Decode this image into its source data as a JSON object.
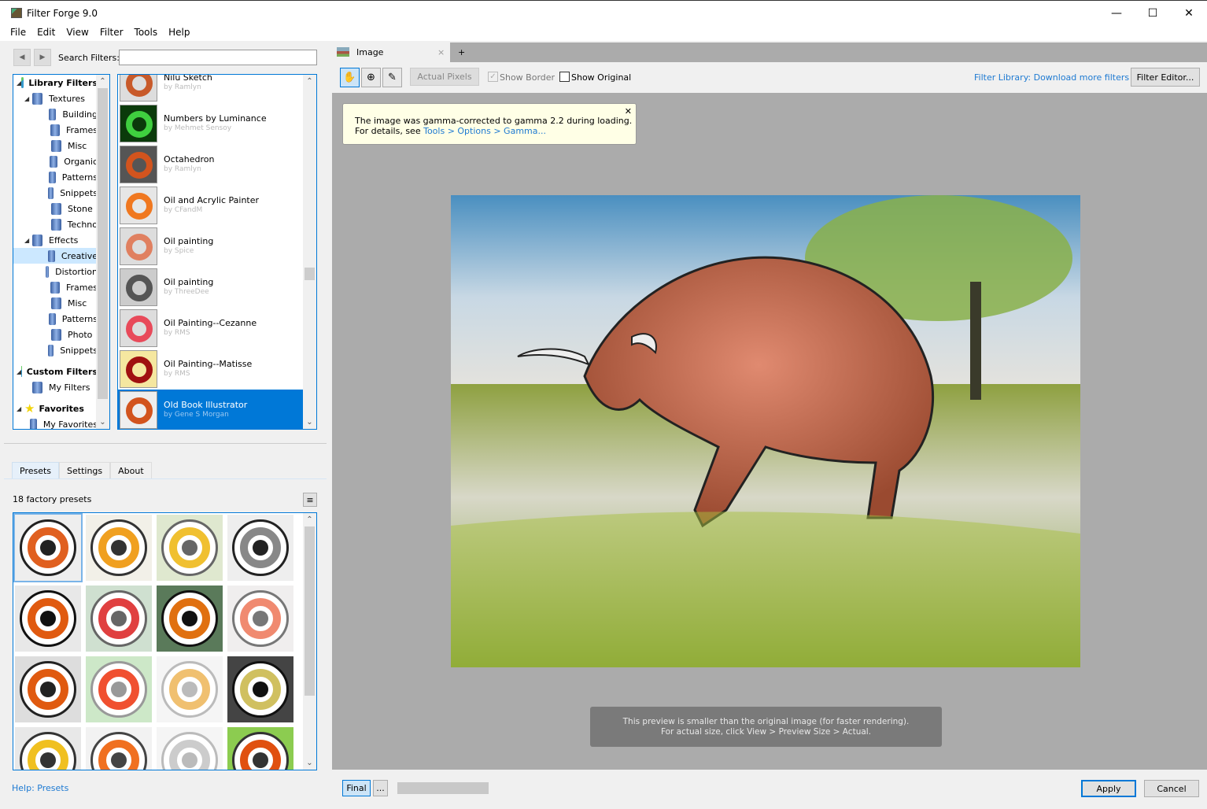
{
  "window": {
    "title": "Filter Forge 9.0",
    "minimize": "—",
    "maximize": "☐",
    "close": "✕"
  },
  "menu": [
    "File",
    "Edit",
    "View",
    "Filter",
    "Tools",
    "Help"
  ],
  "search": {
    "label": "Search Filters:",
    "value": ""
  },
  "tree": [
    {
      "label": "Library Filters",
      "level": 0,
      "bold": true,
      "icon": "cube-icon"
    },
    {
      "label": "Textures",
      "level": 1
    },
    {
      "label": "Building",
      "level": 2
    },
    {
      "label": "Frames",
      "level": 2
    },
    {
      "label": "Misc",
      "level": 2
    },
    {
      "label": "Organic",
      "level": 2
    },
    {
      "label": "Patterns",
      "level": 2
    },
    {
      "label": "Snippets",
      "level": 2
    },
    {
      "label": "Stone",
      "level": 2
    },
    {
      "label": "Techno",
      "level": 2
    },
    {
      "label": "Effects",
      "level": 1
    },
    {
      "label": "Creative",
      "level": 2,
      "selected": true
    },
    {
      "label": "Distortion",
      "level": 2
    },
    {
      "label": "Frames",
      "level": 2
    },
    {
      "label": "Misc",
      "level": 2
    },
    {
      "label": "Patterns",
      "level": 2
    },
    {
      "label": "Photo",
      "level": 2
    },
    {
      "label": "Snippets",
      "level": 2
    },
    {
      "label": "Custom Filters",
      "level": 0,
      "bold": true,
      "icon": "cube-icon"
    },
    {
      "label": "My Filters",
      "level": 1
    },
    {
      "label": "Favorites",
      "level": 0,
      "bold": true,
      "icon": "star-icon"
    },
    {
      "label": "My Favorites",
      "level": 1
    }
  ],
  "filters": [
    {
      "name": "Nilu Sketch",
      "author": "by Ramlyn",
      "colors": [
        "#ddd",
        "#c85a2a"
      ]
    },
    {
      "name": "Numbers by Luminance",
      "author": "by Mehmet Sensoy",
      "colors": [
        "#0b3a0b",
        "#3fcf3f"
      ]
    },
    {
      "name": "Octahedron",
      "author": "by Ramlyn",
      "colors": [
        "#555",
        "#d2541e"
      ]
    },
    {
      "name": "Oil and Acrylic Painter",
      "author": "by CFandM",
      "colors": [
        "#e6e6e6",
        "#f07820"
      ]
    },
    {
      "name": "Oil painting",
      "author": "by Spice",
      "colors": [
        "#ddd",
        "#e08060"
      ]
    },
    {
      "name": "Oil painting",
      "author": "by ThreeDee",
      "colors": [
        "#ccc",
        "#555"
      ]
    },
    {
      "name": "Oil Painting--Cezanne",
      "author": "by RMS",
      "colors": [
        "#ddd",
        "#e84a5a"
      ]
    },
    {
      "name": "Oil Painting--Matisse",
      "author": "by RMS",
      "colors": [
        "#f5e7a0",
        "#a01010"
      ]
    },
    {
      "name": "Old Book Illustrator",
      "author": "by Gene S Morgan",
      "colors": [
        "#eee",
        "#d2541e"
      ],
      "selected": true
    }
  ],
  "tabs": [
    "Presets",
    "Settings",
    "About"
  ],
  "presets_count": "18 factory presets",
  "presets": [
    {
      "bg": "#eee",
      "ring": "#e06020",
      "ink": "#222"
    },
    {
      "bg": "#f2f0e8",
      "ring": "#f0a020",
      "ink": "#333"
    },
    {
      "bg": "#dfe8cf",
      "ring": "#f0c030",
      "ink": "#666"
    },
    {
      "bg": "#eee",
      "ring": "#888",
      "ink": "#222"
    },
    {
      "bg": "#e8e8e8",
      "ring": "#e05a10",
      "ink": "#111"
    },
    {
      "bg": "#cfe0d0",
      "ring": "#e04040",
      "ink": "#666"
    },
    {
      "bg": "#5a7a5a",
      "ring": "#e07010",
      "ink": "#111"
    },
    {
      "bg": "#f0eeee",
      "ring": "#f08a70",
      "ink": "#777"
    },
    {
      "bg": "#ddd",
      "ring": "#e05a10",
      "ink": "#222"
    },
    {
      "bg": "#cde8c8",
      "ring": "#f05030",
      "ink": "#999"
    },
    {
      "bg": "#f5f5f5",
      "ring": "#f0c070",
      "ink": "#bbb"
    },
    {
      "bg": "#444",
      "ring": "#d0c060",
      "ink": "#111"
    },
    {
      "bg": "#e8e8e8",
      "ring": "#f0c020",
      "ink": "#333"
    },
    {
      "bg": "#f2f2f2",
      "ring": "#f07020",
      "ink": "#444"
    },
    {
      "bg": "#f5f5f5",
      "ring": "#ccc",
      "ink": "#bbb"
    },
    {
      "bg": "#8ccc50",
      "ring": "#e05010",
      "ink": "#333"
    }
  ],
  "help_link": "Help: Presets",
  "image_tab": {
    "label": "Image",
    "close": "×",
    "add": "+"
  },
  "toolbar": {
    "actual_pixels": "Actual Pixels",
    "show_border": "Show Border",
    "show_border_checked": true,
    "show_original": "Show Original",
    "show_original_checked": false,
    "library_link": "Filter Library: Download more filters",
    "filter_editor": "Filter Editor..."
  },
  "notice": {
    "line1": "The image was gamma-corrected to gamma 2.2 during loading.",
    "line2_prefix": "For details, see ",
    "link": "Tools > Options > Gamma...",
    "close": "✕"
  },
  "preview_msg": {
    "line1": "This preview is smaller than the original image (for faster rendering).",
    "line2": "For actual size, click View > Preview Size > Actual."
  },
  "bottom": {
    "final": "Final",
    "more": "...",
    "apply": "Apply",
    "cancel": "Cancel"
  },
  "colors": {
    "accent": "#0078d7",
    "canvas": "#ababab",
    "link": "#1e7ad2"
  }
}
